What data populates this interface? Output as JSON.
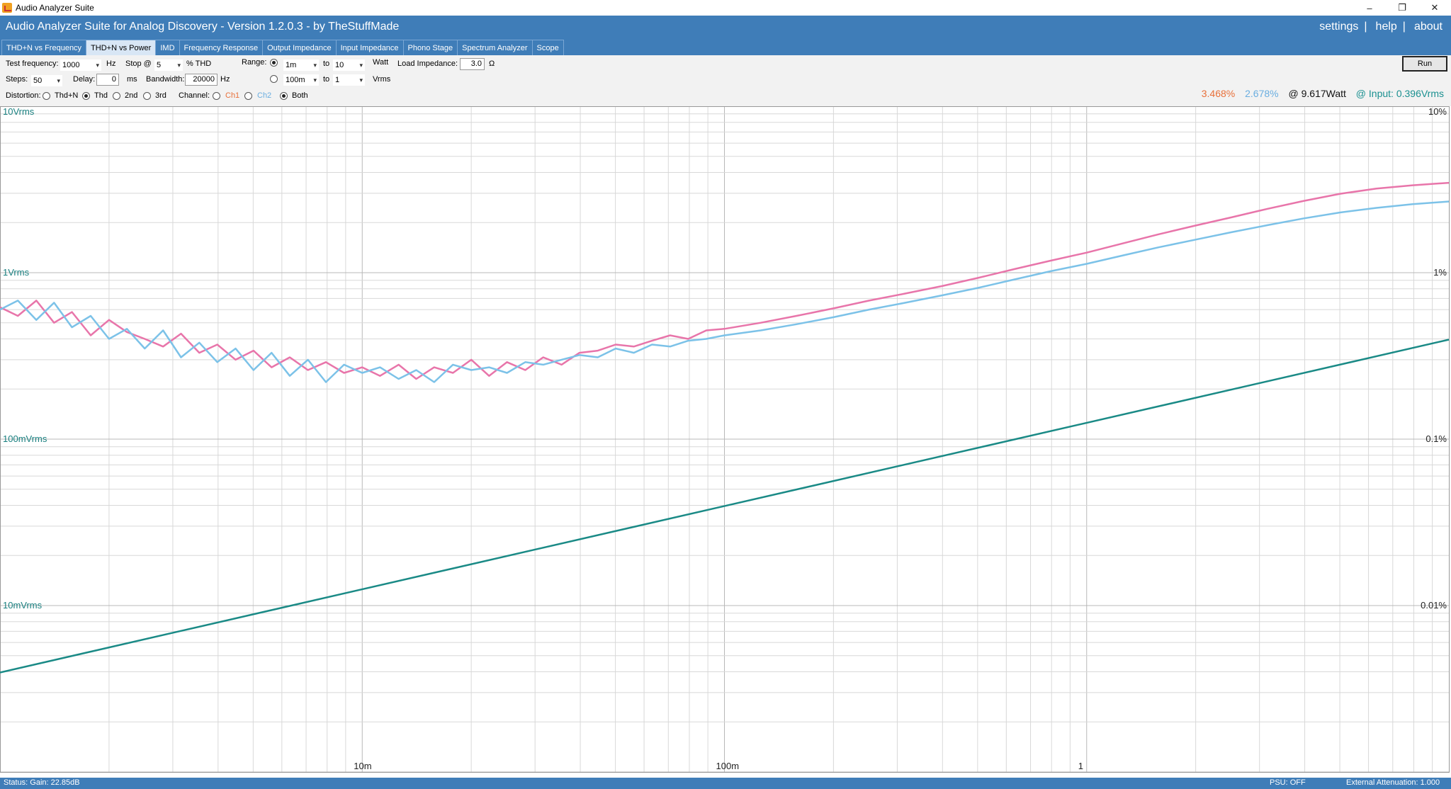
{
  "window": {
    "title": "Audio Analyzer Suite",
    "minimize_glyph": "–",
    "restore_glyph": "❐",
    "close_glyph": "✕"
  },
  "header": {
    "title": "Audio Analyzer Suite for Analog Discovery - Version   1.2.0.3   - by TheStuffMade",
    "links": [
      "settings",
      "help",
      "about"
    ],
    "separator": "|"
  },
  "tabs": [
    {
      "label": "THD+N vs Frequency",
      "active": false
    },
    {
      "label": "THD+N vs Power",
      "active": true
    },
    {
      "label": "IMD",
      "active": false
    },
    {
      "label": "Frequency Response",
      "active": false
    },
    {
      "label": "Output Impedance",
      "active": false
    },
    {
      "label": "Input Impedance",
      "active": false
    },
    {
      "label": "Phono Stage",
      "active": false
    },
    {
      "label": "Spectrum Analyzer",
      "active": false
    },
    {
      "label": "Scope",
      "active": false
    }
  ],
  "controls": {
    "test_frequency_label": "Test frequency:",
    "test_frequency_value": "1000",
    "hz_unit": "Hz",
    "stop_label": "Stop @",
    "stop_value": "5",
    "stop_unit": "% THD",
    "range_label": "Range:",
    "range_watt_from": "1m",
    "range_to_label": "to",
    "range_watt_to": "10",
    "watt_unit": "Watt",
    "range_vrms_from": "100m",
    "range_vrms_to": "1",
    "vrms_unit": "Vrms",
    "range_mode": "watt",
    "load_impedance_label": "Load Impedance:",
    "load_impedance_value": "3.0",
    "ohm_unit": "Ω",
    "steps_label": "Steps:",
    "steps_value": "50",
    "delay_label": "Delay:",
    "delay_value": "0",
    "ms_unit": "ms",
    "bandwidth_label": "Bandwidth:",
    "bandwidth_value": "20000",
    "distortion_label": "Distortion:",
    "distortion_options": [
      "Thd+N",
      "Thd",
      "2nd",
      "3rd"
    ],
    "distortion_selected": "Thd",
    "channel_label": "Channel:",
    "channel_options": [
      "Ch1",
      "Ch2",
      "Both"
    ],
    "channel_selected": "Both",
    "run_label": "Run"
  },
  "readout": {
    "ch1_thd": "3.468%",
    "ch2_thd": "2.678%",
    "power": "@ 9.617Watt",
    "input": "@ Input: 0.396Vrms"
  },
  "colors": {
    "header_blue": "#3f7db8",
    "ch1": "#e875aa",
    "ch2": "#7cc2e8",
    "input_line": "#1a8a86",
    "ch1_readout": "#e8703a",
    "ch2_readout": "#6aaee0",
    "input_readout": "#1a9090"
  },
  "chart_data": {
    "type": "line",
    "xscale": "log",
    "yscale": "log",
    "xlim": [
      0.001,
      10
    ],
    "x_ticks": [
      {
        "value": 0.01,
        "label": "10m"
      },
      {
        "value": 0.1,
        "label": "100m"
      },
      {
        "value": 1,
        "label": "1"
      }
    ],
    "y_left_ticks": [
      {
        "value": 10,
        "label": "10Vrms"
      },
      {
        "value": 1,
        "label": "1Vrms"
      },
      {
        "value": 0.1,
        "label": "100mVrms"
      },
      {
        "value": 0.01,
        "label": "10mVrms"
      }
    ],
    "y_right_ticks": [
      {
        "value": 10,
        "label": "10%"
      },
      {
        "value": 1,
        "label": "1%"
      },
      {
        "value": 0.1,
        "label": "0.1%"
      },
      {
        "value": 0.01,
        "label": "0.01%"
      }
    ],
    "left_ylim": [
      0.001,
      10
    ],
    "right_ylim": [
      0.001,
      10
    ],
    "grid": true,
    "series": [
      {
        "key": "ch1",
        "axis": "right",
        "x": [
          0.001,
          0.00112,
          0.00126,
          0.00141,
          0.00158,
          0.00178,
          0.002,
          0.00224,
          0.00251,
          0.00282,
          0.00316,
          0.00355,
          0.00398,
          0.00447,
          0.00501,
          0.00562,
          0.00631,
          0.00708,
          0.00794,
          0.00891,
          0.01,
          0.0112,
          0.0126,
          0.0141,
          0.0158,
          0.0178,
          0.02,
          0.0224,
          0.0251,
          0.0282,
          0.0316,
          0.0355,
          0.0398,
          0.0447,
          0.0501,
          0.0562,
          0.0631,
          0.0708,
          0.0794,
          0.0891,
          0.1,
          0.126,
          0.158,
          0.2,
          0.251,
          0.316,
          0.398,
          0.501,
          0.631,
          0.794,
          1,
          1.26,
          1.58,
          2,
          2.51,
          3.16,
          3.98,
          5.01,
          6.31,
          7.94,
          10
        ],
        "y": [
          0.62,
          0.55,
          0.68,
          0.5,
          0.58,
          0.42,
          0.52,
          0.44,
          0.4,
          0.36,
          0.43,
          0.33,
          0.37,
          0.3,
          0.34,
          0.27,
          0.31,
          0.26,
          0.29,
          0.25,
          0.27,
          0.24,
          0.28,
          0.23,
          0.27,
          0.25,
          0.3,
          0.24,
          0.29,
          0.26,
          0.31,
          0.28,
          0.33,
          0.34,
          0.37,
          0.36,
          0.39,
          0.42,
          0.4,
          0.45,
          0.46,
          0.5,
          0.55,
          0.61,
          0.68,
          0.75,
          0.83,
          0.93,
          1.05,
          1.18,
          1.32,
          1.5,
          1.7,
          1.92,
          2.15,
          2.42,
          2.7,
          2.98,
          3.2,
          3.35,
          3.468
        ]
      },
      {
        "key": "ch2",
        "axis": "right",
        "x": [
          0.001,
          0.00112,
          0.00126,
          0.00141,
          0.00158,
          0.00178,
          0.002,
          0.00224,
          0.00251,
          0.00282,
          0.00316,
          0.00355,
          0.00398,
          0.00447,
          0.00501,
          0.00562,
          0.00631,
          0.00708,
          0.00794,
          0.00891,
          0.01,
          0.0112,
          0.0126,
          0.0141,
          0.0158,
          0.0178,
          0.02,
          0.0224,
          0.0251,
          0.0282,
          0.0316,
          0.0355,
          0.0398,
          0.0447,
          0.0501,
          0.0562,
          0.0631,
          0.0708,
          0.0794,
          0.0891,
          0.1,
          0.126,
          0.158,
          0.2,
          0.251,
          0.316,
          0.398,
          0.501,
          0.631,
          0.794,
          1,
          1.26,
          1.58,
          2,
          2.51,
          3.16,
          3.98,
          5.01,
          6.31,
          7.94,
          10
        ],
        "y": [
          0.6,
          0.68,
          0.52,
          0.66,
          0.47,
          0.55,
          0.4,
          0.46,
          0.35,
          0.45,
          0.31,
          0.38,
          0.29,
          0.35,
          0.26,
          0.33,
          0.24,
          0.3,
          0.22,
          0.28,
          0.25,
          0.27,
          0.23,
          0.26,
          0.22,
          0.28,
          0.26,
          0.27,
          0.25,
          0.29,
          0.28,
          0.3,
          0.32,
          0.31,
          0.35,
          0.33,
          0.37,
          0.36,
          0.39,
          0.4,
          0.42,
          0.45,
          0.49,
          0.54,
          0.6,
          0.66,
          0.73,
          0.81,
          0.91,
          1.02,
          1.13,
          1.27,
          1.42,
          1.58,
          1.75,
          1.93,
          2.12,
          2.3,
          2.45,
          2.58,
          2.678
        ]
      },
      {
        "key": "input",
        "axis": "left",
        "x": [
          0.001,
          10
        ],
        "y": [
          0.00396,
          0.396
        ]
      }
    ]
  },
  "status": {
    "left": "Status: Gain: 22.85dB",
    "psu": "PSU: OFF",
    "attenuation": "External Attenuation: 1.000"
  }
}
